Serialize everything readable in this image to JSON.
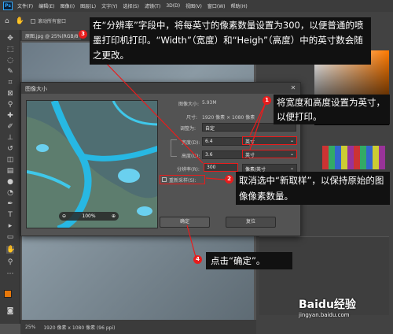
{
  "app": {
    "logo": "Ps"
  },
  "menu": [
    "文件(F)",
    "编辑(E)",
    "图像(I)",
    "图层(L)",
    "文字(Y)",
    "选择(S)",
    "滤镜(T)",
    "3D(D)",
    "视图(V)",
    "窗口(W)",
    "帮助(H)"
  ],
  "optbar": {
    "scroll_all": "滚动所有窗口"
  },
  "doc_tab": {
    "title": "原图.jpg @ 25%(RGB/8"
  },
  "status": {
    "zoom": "25%",
    "doc_size": "1920 像素 x 1080 像素 (96 ppi)"
  },
  "dialog": {
    "title": "图像大小",
    "image_size_label": "图像大小:",
    "image_size_value": "5.93M",
    "dimensions_label": "尺寸:",
    "dimensions_value": "1920 像素 × 1080 像素",
    "fit_label": "调整为:",
    "fit_value": "自定",
    "width_label": "宽度(D):",
    "width_value": "6.4",
    "width_unit": "英寸",
    "height_label": "高度(G):",
    "height_value": "3.6",
    "height_unit": "英寸",
    "resolution_label": "分辨率(R):",
    "resolution_value": "300",
    "resolution_unit": "像素/英寸",
    "resample_label": "重新采样(S):",
    "resample_checked": false,
    "preview_zoom": "100%",
    "ok_label": "确定",
    "reset_label": "复位"
  },
  "callouts": {
    "top": "在“分辨率”字段中，将每英寸的像素数量设置为300，以便普通的喷墨打印机打印。“Width”（宽度）和“Heigh”（高度）中的英寸数会随之更改。",
    "c1": "将宽度和高度设置为英寸，以便打印。",
    "c2": "取消选中“新取样”，以保持原始的图像像素数量。",
    "c4": "点击“确定”。"
  },
  "badges": {
    "b1": "1",
    "b2": "2",
    "b3": "3",
    "b4": "4"
  },
  "watermark": {
    "brand": "Baidu经验",
    "url": "jingyan.baidu.com"
  },
  "colors": {
    "accent_red": "#e81c1c",
    "ps_blue": "#31a8ff"
  },
  "icons": [
    "home-icon",
    "hand-icon",
    "move-icon",
    "marquee-icon",
    "lasso-icon",
    "crop-icon",
    "eyedropper-icon",
    "brush-icon",
    "eraser-icon",
    "text-icon",
    "zoom-icon",
    "close-icon"
  ]
}
